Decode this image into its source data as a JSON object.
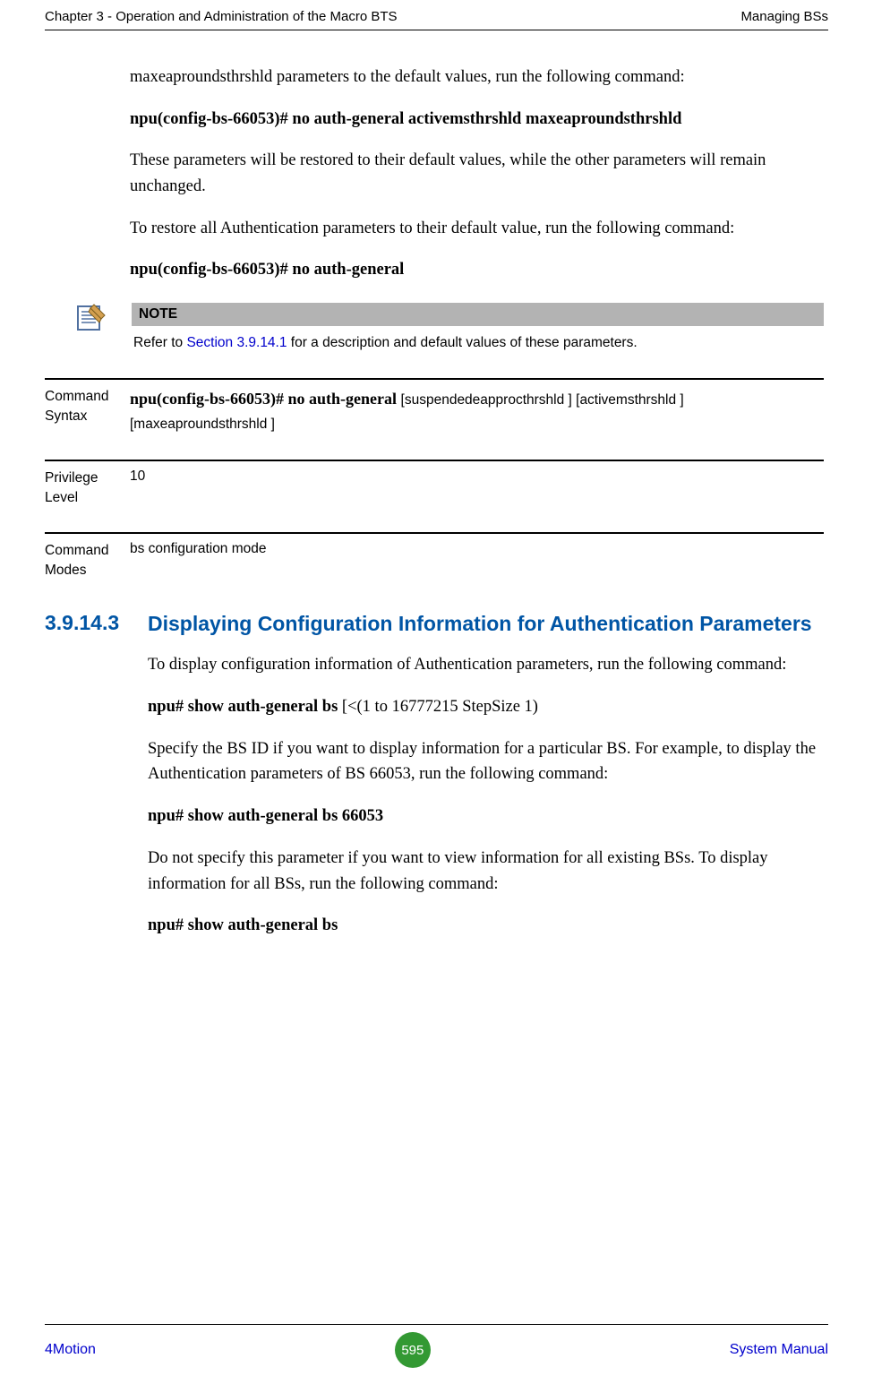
{
  "header": {
    "left": "Chapter 3 - Operation and Administration of the Macro BTS",
    "right": "Managing BSs"
  },
  "body": {
    "p1": "maxeaproundsthrshld parameters to the default values, run the following command:",
    "p2": "npu(config-bs-66053)# no auth-general activemsthrshld maxeaproundsthrshld",
    "p3": "These parameters will be restored to their default values, while the other parameters will remain unchanged.",
    "p4": "To restore all Authentication parameters to their default value, run the following command:",
    "p5": "npu(config-bs-66053)# no auth-general"
  },
  "note": {
    "header": "NOTE",
    "pre": "Refer to ",
    "link": "Section 3.9.14.1",
    "post": " for a description and default values of these parameters."
  },
  "rows": {
    "syntax": {
      "label": "Command Syntax",
      "bold": "npu(config-bs-66053)# no auth-general ",
      "rest": "[suspendedeapprocthrshld ] [activemsthrshld ] [maxeaproundsthrshld ]"
    },
    "privilege": {
      "label": "Privilege Level",
      "value": "10"
    },
    "modes": {
      "label": "Command Modes",
      "value": "bs configuration mode"
    }
  },
  "section": {
    "num": "3.9.14.3",
    "title": "Displaying Configuration Information for Authentication Parameters"
  },
  "body2": {
    "p1": "To display configuration information of Authentication parameters, run the following command:",
    "p2a": "npu# show auth-general bs ",
    "p2b": "[<(1 to 16777215 StepSize 1)",
    "p3": "Specify the BS ID if you want to display information for a particular BS. For example, to display the Authentication parameters of BS 66053, run the following command:",
    "p4": "npu# show auth-general bs 66053",
    "p5": "Do not specify this parameter if you want to view information for all existing BSs. To display information for all BSs, run the following command:",
    "p6": "npu# show auth-general bs"
  },
  "footer": {
    "left": "4Motion",
    "page": "595",
    "right": " System Manual"
  }
}
